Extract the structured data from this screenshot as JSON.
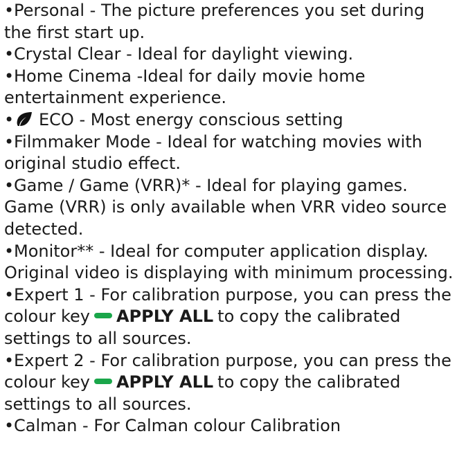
{
  "items": [
    {
      "lines": [
        "Personal - The picture preferences you set during",
        "the first start up."
      ]
    },
    {
      "lines": [
        "Crystal Clear - Ideal for daylight viewing."
      ]
    },
    {
      "lines": [
        "Home Cinema -Ideal for daily movie home",
        "entertainment experience."
      ]
    },
    {
      "eco_icon": "eco-leaf-icon",
      "lines": [
        "ECO - Most energy conscious setting"
      ]
    },
    {
      "lines": [
        "Filmmaker Mode - Ideal for watching movies with",
        "original studio effect."
      ]
    },
    {
      "lines": [
        "Game / Game (VRR)* - Ideal for playing games.",
        "Game (VRR) is only available when VRR video source",
        "detected."
      ]
    },
    {
      "lines": [
        "Monitor** - Ideal for computer application display.",
        "Original video is displaying with minimum processing."
      ]
    },
    {
      "lines": [
        "Expert 1 - For calibration purpose, you can press the"
      ],
      "key_line_prefix": "colour key",
      "key_label": "APPLY ALL",
      "key_line_suffix": "to copy the calibrated",
      "tail_line": "settings to all sources."
    },
    {
      "lines": [
        "Expert 2 - For calibration purpose, you can press the"
      ],
      "key_line_prefix": "colour key",
      "key_label": "APPLY ALL",
      "key_line_suffix": "to copy the calibrated",
      "tail_line": "settings to all sources."
    },
    {
      "lines": [
        "Calman - For Calman colour Calibration"
      ]
    }
  ],
  "bullet_char": "•",
  "colors": {
    "text": "#1a1a1a",
    "green_key": "#1aa64a"
  }
}
